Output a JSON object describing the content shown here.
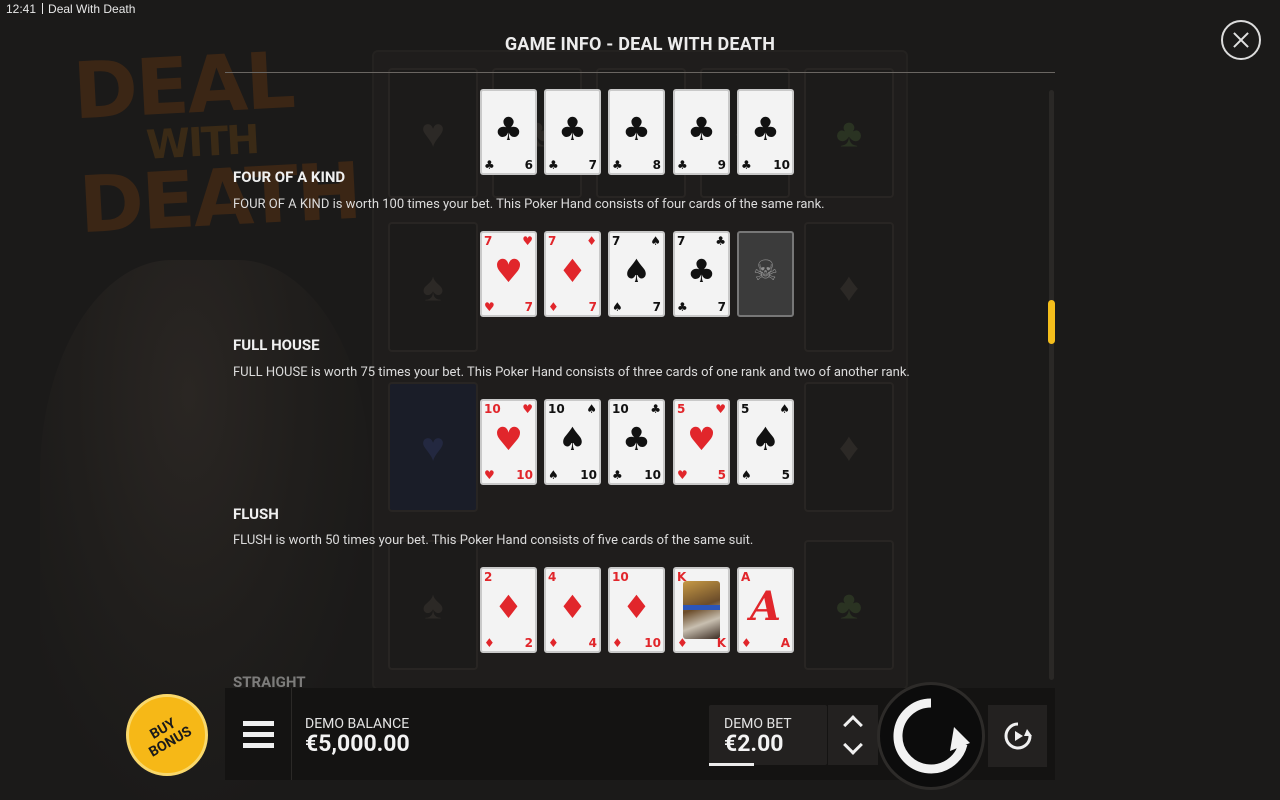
{
  "status_bar": {
    "time": "12:41",
    "game_name": "Deal With Death"
  },
  "info": {
    "title": "GAME INFO - DEAL WITH DEATH",
    "sections": [
      {
        "heading": "FOUR OF A KIND",
        "description": "FOUR OF A KIND is worth 100 times your bet. This Poker Hand consists of four cards of the same rank.",
        "cards": [
          {
            "rank": "7",
            "suit": "♥",
            "color": "red"
          },
          {
            "rank": "7",
            "suit": "♦",
            "color": "red"
          },
          {
            "rank": "7",
            "suit": "♠",
            "color": "black"
          },
          {
            "rank": "7",
            "suit": "♣",
            "color": "black"
          },
          {
            "rank": "",
            "suit": "☠",
            "color": "wild"
          }
        ]
      },
      {
        "heading": "FULL HOUSE",
        "description": "FULL HOUSE is worth 75 times your bet. This Poker Hand consists of three cards of one rank and two of another rank.",
        "cards": [
          {
            "rank": "10",
            "suit": "♥",
            "color": "red"
          },
          {
            "rank": "10",
            "suit": "♠",
            "color": "black"
          },
          {
            "rank": "10",
            "suit": "♣",
            "color": "black"
          },
          {
            "rank": "5",
            "suit": "♥",
            "color": "red"
          },
          {
            "rank": "5",
            "suit": "♠",
            "color": "black"
          }
        ]
      },
      {
        "heading": "FLUSH",
        "description": "FLUSH is worth 50 times your bet. This Poker Hand consists of five cards of the same suit.",
        "cards": [
          {
            "rank": "2",
            "suit": "♦",
            "color": "red"
          },
          {
            "rank": "4",
            "suit": "♦",
            "color": "red"
          },
          {
            "rank": "10",
            "suit": "♦",
            "color": "red"
          },
          {
            "rank": "K",
            "suit": "♦",
            "color": "king"
          },
          {
            "rank": "A",
            "suit": "♦",
            "color": "ace"
          }
        ]
      }
    ],
    "top_cards": [
      {
        "rank": "6",
        "suit": "♣"
      },
      {
        "rank": "7",
        "suit": "♣"
      },
      {
        "rank": "8",
        "suit": "♣"
      },
      {
        "rank": "9",
        "suit": "♣"
      },
      {
        "rank": "10",
        "suit": "♣"
      }
    ],
    "next_heading": "STRAIGHT"
  },
  "background": {
    "logo_lines": [
      "DEAL",
      "WITH",
      "DEATH"
    ]
  },
  "bottom_bar": {
    "buy_bonus": "BUY BONUS",
    "balance_label": "DEMO BALANCE",
    "balance_value": "€5,000.00",
    "bet_label": "DEMO BET",
    "bet_value": "€2.00"
  },
  "colors": {
    "accent": "#f4be1c",
    "red_suit": "#e1262b",
    "buy_bonus": "#f6b817"
  },
  "icons": [
    "close-icon",
    "menu-icon",
    "spin-icon",
    "autoplay-icon",
    "arrow-up-icon",
    "arrow-down-icon"
  ]
}
